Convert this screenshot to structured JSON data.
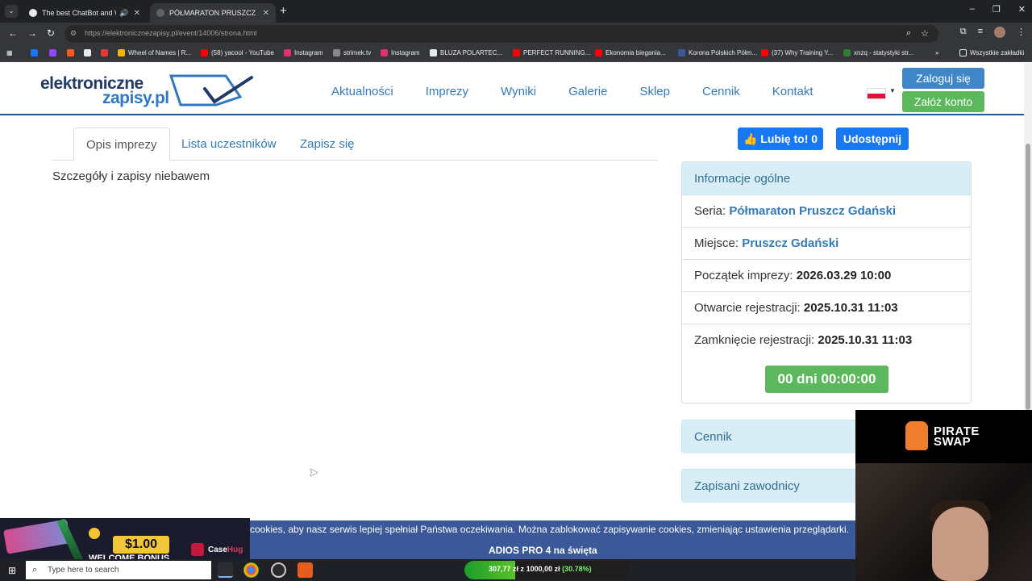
{
  "browser": {
    "tabs": [
      {
        "title": "The best ChatBot and Widg",
        "favicon_color": "#e8eaed"
      },
      {
        "title": "PÓŁMARATON PRUSZCZ GDAŃ",
        "favicon_color": "#9aa0a6"
      }
    ],
    "url_host": "https://elektronicznezapisy.pl",
    "url_path": "/event/14006/strona.html",
    "bookmarks": [
      {
        "label": "",
        "color": "#1877f2"
      },
      {
        "label": "",
        "color": "#9146ff"
      },
      {
        "label": "",
        "color": "#ff5722"
      },
      {
        "label": "",
        "color": "#e8eaed"
      },
      {
        "label": "",
        "color": "#e53935"
      },
      {
        "label": "Wheel of Names | R...",
        "color": "#f4b400"
      },
      {
        "label": "(58) yacool - YouTube",
        "color": "#ff0000"
      },
      {
        "label": "Instagram",
        "color": "#e1306c"
      },
      {
        "label": "strimek.tv",
        "color": "#888888"
      },
      {
        "label": "Instagram",
        "color": "#e1306c"
      },
      {
        "label": "BLUZA POLARTEC...",
        "color": "#e8eaed"
      },
      {
        "label": "PERFECT RUNNING...",
        "color": "#ff0000"
      },
      {
        "label": "Ekonomia biegania...",
        "color": "#ff0000"
      },
      {
        "label": "Korona Polskich Półm...",
        "color": "#3b5998"
      },
      {
        "label": "(37) Why Training Y...",
        "color": "#ff0000"
      },
      {
        "label": "xnzq - statystyki str...",
        "color": "#2e7d32"
      }
    ],
    "all_bookmarks": "Wszystkie zakładki"
  },
  "site": {
    "logo_line1": "elektroniczne",
    "logo_line2": "zapisy.pl",
    "menu": [
      "Aktualności",
      "Imprezy",
      "Wyniki",
      "Galerie",
      "Sklep",
      "Cennik",
      "Kontakt"
    ],
    "login": "Zaloguj się",
    "register": "Załóż konto"
  },
  "tabs": {
    "description": "Opis imprezy",
    "participants": "Lista uczestników",
    "signup": "Zapisz się"
  },
  "content": {
    "description_text": "Szczegóły i zapisy niebawem"
  },
  "social": {
    "like": "Lubię to! 0",
    "share": "Udostępnij"
  },
  "info": {
    "heading": "Informacje ogólne",
    "series_label": "Seria:",
    "series_value": "Półmaraton Pruszcz Gdański",
    "place_label": "Miejsce:",
    "place_value": "Pruszcz Gdański",
    "start_label": "Początek imprezy:",
    "start_value": "2026.03.29 10:00",
    "reg_open_label": "Otwarcie rejestracji:",
    "reg_open_value": "2025.10.31 11:03",
    "reg_close_label": "Zamknięcie rejestracji:",
    "reg_close_value": "2025.10.31 11:03",
    "countdown": "00 dni 00:00:00"
  },
  "panels": {
    "price": "Cennik",
    "registered": "Zapisani zawodnicy"
  },
  "cookie": {
    "text": "cookies, aby nasz serwis lepiej spełniał Państwa oczekiwania. Można zablokować zapisywanie cookies, zmieniając ustawienia przeglądarki.",
    "sub": "ADIOS PRO 4 na święta"
  },
  "promo": {
    "amount": "$1.00",
    "bonus": "WELCOME BONUS",
    "brand_a": "Case",
    "brand_b": "Hug"
  },
  "webcam": {
    "brand_line1": "PIRATE",
    "brand_line2": "SWAP"
  },
  "taskbar": {
    "search_placeholder": "Type here to search",
    "donation_current": "307,77 zł",
    "donation_middle": "z",
    "donation_goal": "1000,00 zł",
    "donation_percent": "(30.78%)",
    "donation_fraction": 0.3078
  }
}
